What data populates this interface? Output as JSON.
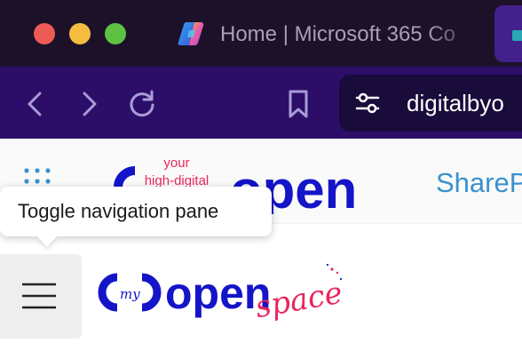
{
  "browser": {
    "tab_title": "Home | Microsoft 365 Co",
    "address_text": "digitalbyo",
    "icons": {
      "back": "chevron-left-icon",
      "forward": "chevron-right-icon",
      "reload": "reload-icon",
      "bookmark": "bookmark-icon",
      "site_settings": "sliders-icon",
      "tab": "copilot-icon"
    }
  },
  "app": {
    "suite_label": "ShareP",
    "logo_top": {
      "wordmark": "open",
      "tagline_line1": "your",
      "tagline_line2": "high-digital"
    },
    "logo_main": {
      "prefix": "my",
      "wordmark": "open",
      "suffix": "space"
    },
    "tooltip": "Toggle navigation pane"
  },
  "colors": {
    "titlebar_bg": "#1d1129",
    "toolbar_bg": "#2c0e69",
    "brand_blue": "#1414c8",
    "brand_pink": "#e8265f",
    "sharepoint_blue": "#3a91cf"
  }
}
